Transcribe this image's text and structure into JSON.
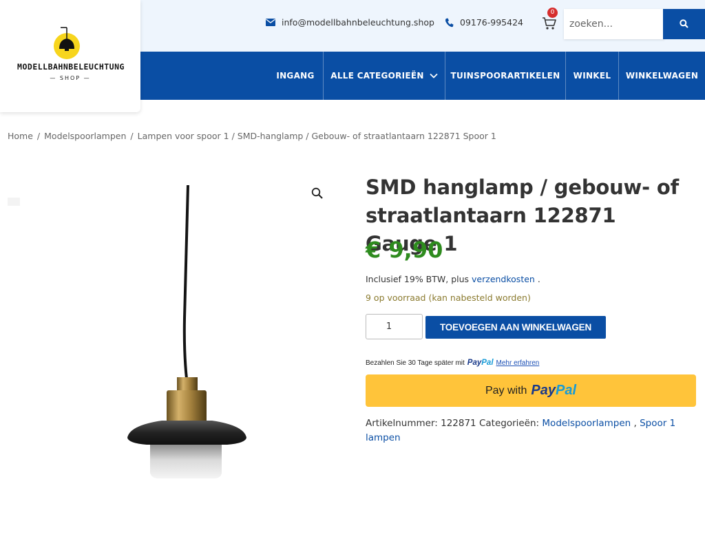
{
  "header": {
    "logo_word": "MODELLBAHNBELEUCHTUNG",
    "logo_shop": "— SHOP —",
    "email": "info@modellbahnbeleuchtung.shop",
    "phone": "09176-995424",
    "cart_count": "0",
    "search_placeholder": "zoeken...",
    "colors": {
      "primary": "#0a4ea4",
      "topbar_bg": "#eef5fd",
      "logo_yellow": "#f7d51d",
      "badge": "#d62d2d"
    }
  },
  "nav": {
    "items": [
      {
        "label": "INGANG"
      },
      {
        "label": "ALLE CATEGORIEËN",
        "icon": "chevron-down-icon"
      },
      {
        "label": "TUINSPOORARTIKELEN"
      },
      {
        "label": "WINKEL"
      },
      {
        "label": "WINKELWAGEN"
      }
    ]
  },
  "breadcrumb": {
    "items": [
      "Home",
      "Modelspoorlampen",
      "Lampen voor spoor 1"
    ],
    "current": "/ SMD-hanglamp / Gebouw- of straatlantaarn 122871 Spoor 1",
    "separator": "/"
  },
  "product": {
    "title": "SMD hanglamp / gebouw- of straatlantaarn 122871 Gauge 1",
    "price": "€ 9,90",
    "tax_prefix": "Inclusief 19% BTW, plus",
    "tax_link": "verzendkosten",
    "tax_suffix": ".",
    "stock": "9 op voorraad (kan nabesteld worden)",
    "quantity": "1",
    "add_to_cart": "TOEVOEGEN AAN WINKELWAGEN",
    "paypal_message": "Bezahlen Sie 30 Tage später mit",
    "paypal_link": "Mehr erfahren",
    "paypal_button_text": "Pay with",
    "paypal_logo_1": "Pay",
    "paypal_logo_2": "Pal",
    "meta_sku_label": "Artikelnummer:",
    "meta_sku": "122871",
    "meta_cat_label": "Categorieën:",
    "meta_cat_1": "Modelspoorlampen",
    "meta_cat_sep": ",",
    "meta_cat_2": "Spoor 1 lampen",
    "colors": {
      "price": "#2e8b1e",
      "stock": "#8a7a2e",
      "paypal_bg": "#ffc43a"
    }
  }
}
